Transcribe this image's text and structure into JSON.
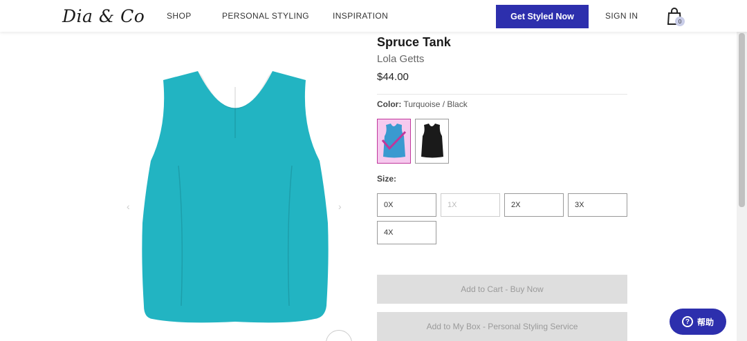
{
  "header": {
    "logo": "Dia & Co",
    "nav": [
      "SHOP",
      "PERSONAL STYLING",
      "INSPIRATION"
    ],
    "cta_label": "Get Styled Now",
    "sign_in": "SIGN IN",
    "cart_count": "0"
  },
  "product": {
    "title": "Spruce Tank",
    "brand": "Lola Getts",
    "price": "$44.00",
    "color_label": "Color:",
    "color_value": "Turquoise / Black",
    "swatches": [
      {
        "name": "Turquoise",
        "color": "#3a9ad0",
        "selected": true
      },
      {
        "name": "Black",
        "color": "#1a1a1a",
        "selected": false
      }
    ],
    "image_color": "#22b4c2",
    "size_label": "Size:",
    "sizes": [
      {
        "label": "0X",
        "available": true
      },
      {
        "label": "1X",
        "available": false
      },
      {
        "label": "2X",
        "available": true
      },
      {
        "label": "3X",
        "available": true
      },
      {
        "label": "4X",
        "available": true
      }
    ],
    "add_to_cart": "Add to Cart - Buy Now",
    "add_to_box": "Add to My Box - Personal Styling Service"
  },
  "help": {
    "label": "帮助",
    "icon": "question-circle-icon"
  },
  "colors": {
    "brand": "#2d2fad",
    "selected_swatch_bg": "#f6c9ee",
    "disabled_button": "#dedede"
  }
}
